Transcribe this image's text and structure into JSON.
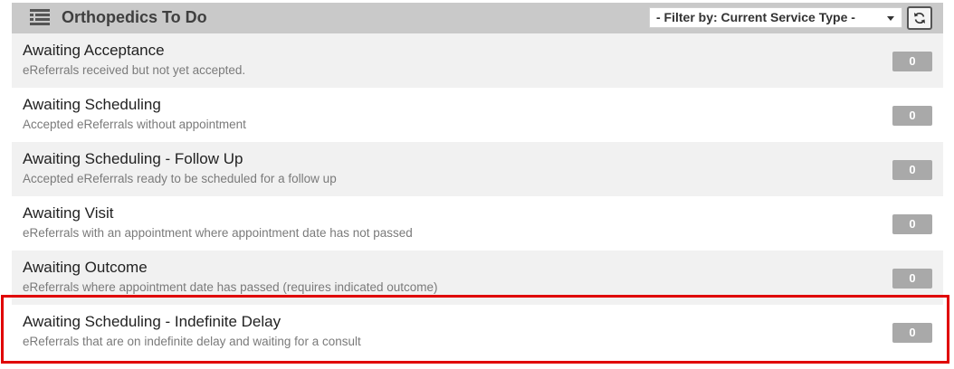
{
  "header": {
    "icon": "list-icon",
    "title": "Orthopedics To Do",
    "filter": {
      "selected": "- Filter by: Current Service Type -",
      "icon": "chevron-down-icon"
    },
    "refresh_icon": "refresh-icon"
  },
  "rows": [
    {
      "title": "Awaiting Acceptance",
      "description": "eReferrals received but not yet accepted.",
      "count": "0"
    },
    {
      "title": "Awaiting Scheduling",
      "description": "Accepted eReferrals without appointment",
      "count": "0"
    },
    {
      "title": "Awaiting Scheduling - Follow Up",
      "description": "Accepted eReferrals ready to be scheduled for a follow up",
      "count": "0"
    },
    {
      "title": "Awaiting Visit",
      "description": "eReferrals with an appointment where appointment date has not passed",
      "count": "0"
    },
    {
      "title": "Awaiting Outcome",
      "description": "eReferrals where appointment date has passed (requires indicated outcome)",
      "count": "0"
    },
    {
      "title": "Awaiting Scheduling - Indefinite Delay",
      "description": "eReferrals that are on indefinite delay and waiting for a consult",
      "count": "0"
    }
  ],
  "colors": {
    "header_bg": "#c9c9c9",
    "badge_bg": "#a9a9a9",
    "highlight_border": "#e00000"
  }
}
